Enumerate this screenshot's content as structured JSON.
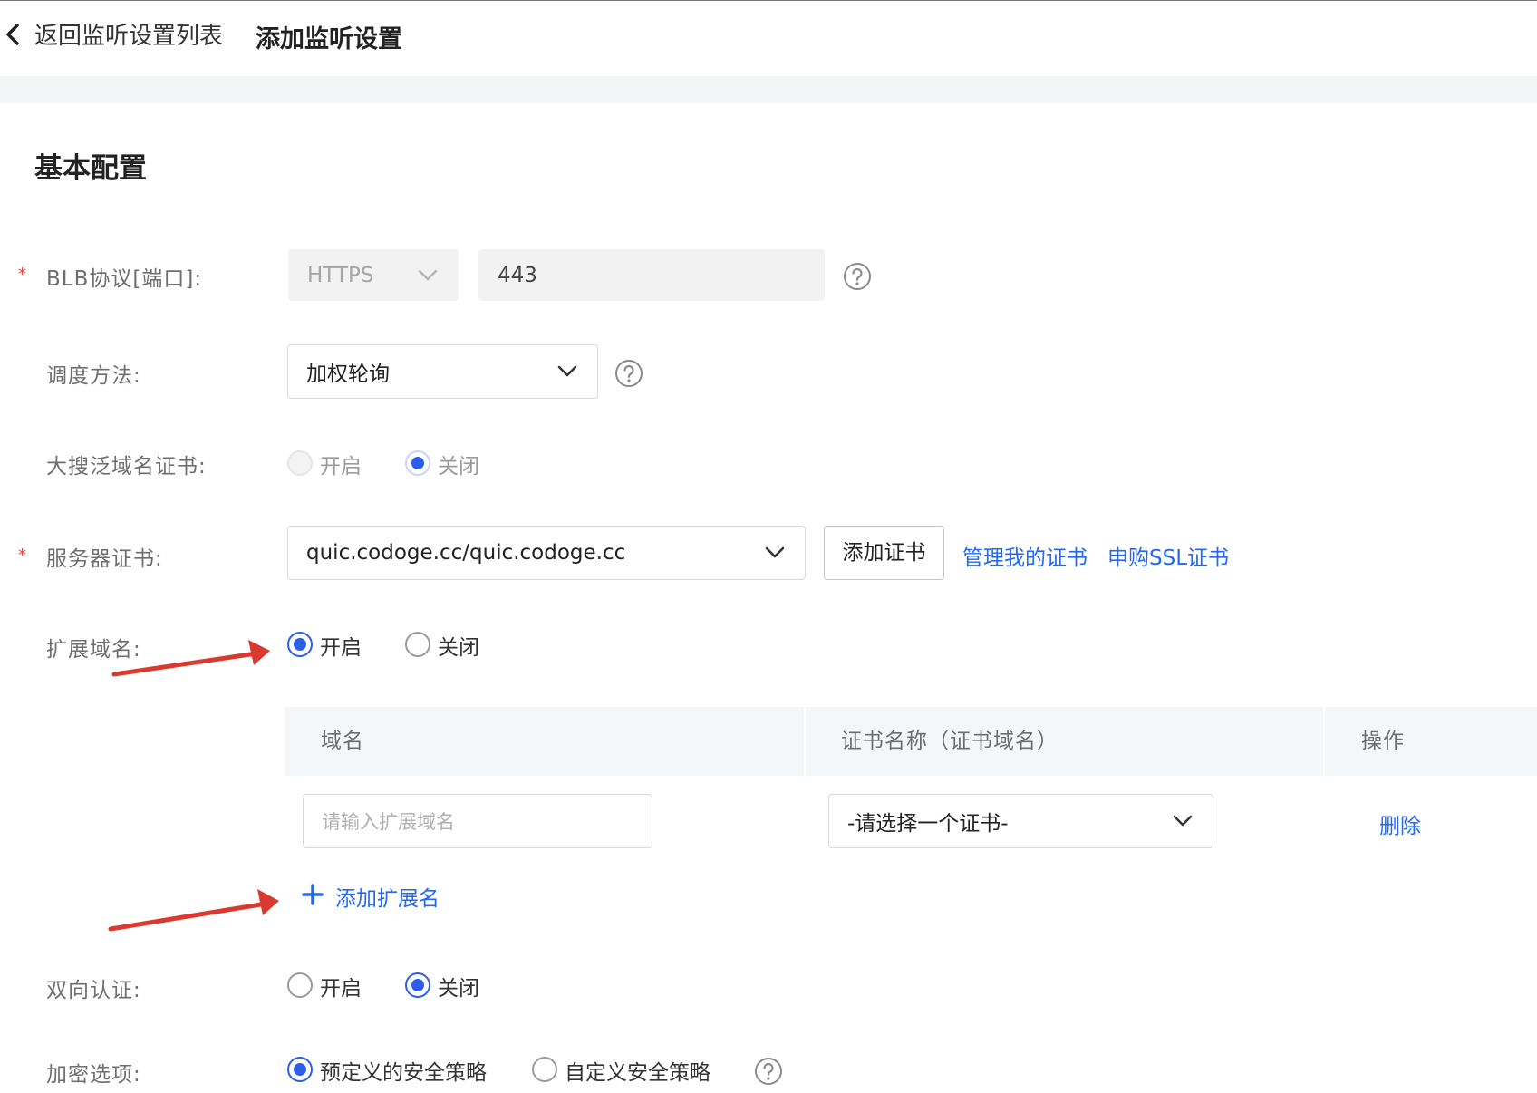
{
  "header": {
    "back_label": "返回监听设置列表",
    "title": "添加监听设置"
  },
  "section": {
    "title": "基本配置"
  },
  "fields": {
    "protocol": {
      "label": "BLB协议[端口]:",
      "required_mark": "*",
      "protocol_value": "HTTPS",
      "port_value": "443"
    },
    "schedule": {
      "label": "调度方法:",
      "value": "加权轮询"
    },
    "wildcard_cert": {
      "label": "大搜泛域名证书:",
      "options": [
        "开启",
        "关闭"
      ],
      "selected": "关闭"
    },
    "server_cert": {
      "label": "服务器证书:",
      "required_mark": "*",
      "value": "quic.codoge.cc/quic.codoge.cc",
      "add_button": "添加证书",
      "manage_link": "管理我的证书",
      "buy_link": "申购SSL证书"
    },
    "ext_domain": {
      "label": "扩展域名:",
      "options": [
        "开启",
        "关闭"
      ],
      "selected": "开启",
      "table": {
        "headers": [
          "域名",
          "证书名称（证书域名）",
          "操作"
        ],
        "row": {
          "domain_placeholder": "请输入扩展域名",
          "cert_select": "-请选择一个证书-",
          "action": "删除"
        }
      },
      "add_label": "添加扩展名"
    },
    "mutual_auth": {
      "label": "双向认证:",
      "options": [
        "开启",
        "关闭"
      ],
      "selected": "关闭"
    },
    "encryption": {
      "label": "加密选项:",
      "options": [
        "预定义的安全策略",
        "自定义安全策略"
      ],
      "selected": "预定义的安全策略"
    }
  },
  "colors": {
    "accent": "#2b5fe8",
    "link": "#2468f2",
    "required": "#e8443b",
    "annotation_arrow": "#d93a30"
  }
}
